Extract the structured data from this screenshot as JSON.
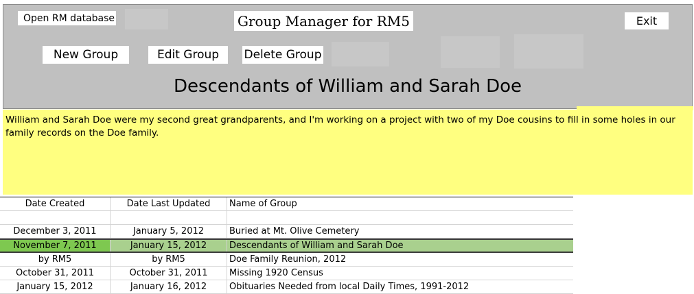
{
  "app": {
    "title": "Group Manager for RM5",
    "open_db_label": "Open RM database",
    "exit_label": "Exit"
  },
  "toolbar": {
    "new_group_label": "New Group",
    "edit_group_label": "Edit Group",
    "delete_group_label": "Delete  Group"
  },
  "selected_group": {
    "name": "Descendants of William and Sarah Doe",
    "description": "William and Sarah Doe were my second great grandparents, and I'm working on a project with two of my Doe cousins to fill in some holes in our family records on the Doe family."
  },
  "table": {
    "headers": [
      "Date Created",
      "Date Last Updated",
      "Name of Group"
    ],
    "rows": [
      {
        "created": "",
        "updated": "",
        "name": ""
      },
      {
        "created": "December 3, 2011",
        "updated": "January 5, 2012",
        "name": "Buried at Mt. Olive Cemetery"
      },
      {
        "created": "November 7, 2011",
        "updated": "January 15, 2012",
        "name": "Descendants of William and Sarah Doe",
        "selected": true
      },
      {
        "created": "by RM5",
        "updated": "by RM5",
        "name": "Doe Family Reunion, 2012"
      },
      {
        "created": "October 31, 2011",
        "updated": "October 31, 2011",
        "name": "Missing 1920 Census"
      },
      {
        "created": "January 15, 2012",
        "updated": "January 16, 2012",
        "name": "Obituaries Needed from local Daily Times, 1991-2012"
      }
    ]
  },
  "colors": {
    "header_bg": "#c0c0c0",
    "description_bg": "#ffff80",
    "selected_row_bg": "#a9d08e",
    "selected_first_cell_bg": "#7ec850"
  }
}
